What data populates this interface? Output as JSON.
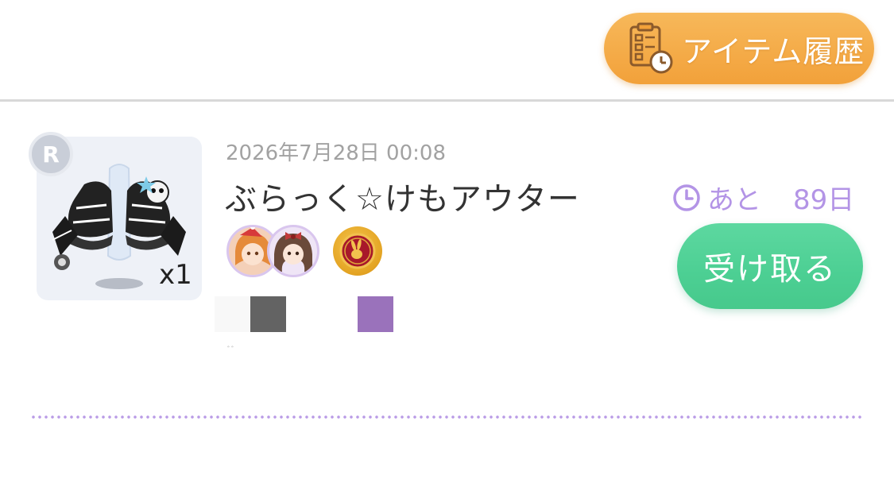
{
  "header": {
    "history_button_label": "アイテム履歴"
  },
  "item": {
    "rarity": "R",
    "quantity": "x1",
    "date": "2026年7月28日 00:08",
    "name": "ぶらっく☆けもアウター",
    "remaining_prefix": "あと",
    "remaining_days": "89日",
    "receive_label": "受け取る",
    "swatch_caption": "ﾞﾞ",
    "swatch_colors": [
      "#f8f8f8",
      "#636363",
      "#9a72bb"
    ]
  },
  "colors": {
    "history_button": "#f2a13a",
    "receive_button": "#4ccf93",
    "accent_purple": "#b394e6",
    "date_gray": "#a2a2a2"
  },
  "icons": {
    "history": "checklist-clock-icon",
    "remaining": "clock-icon",
    "coin": "rabbit-coin-icon"
  }
}
